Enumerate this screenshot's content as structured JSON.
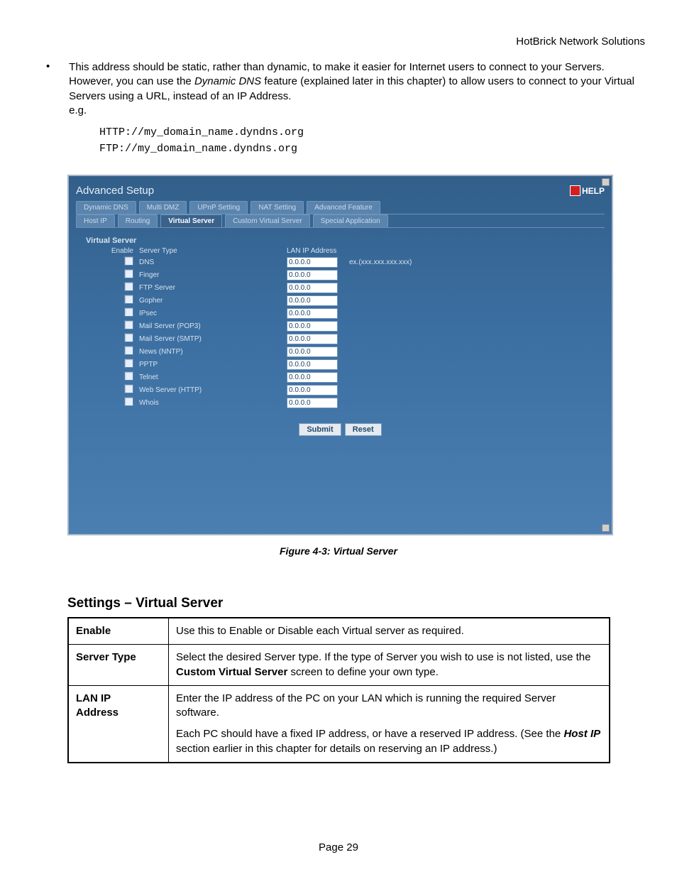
{
  "header": {
    "company": "HotBrick Network Solutions"
  },
  "bullet": {
    "text_before_italic": "This address should be static, rather than dynamic, to make it easier for Internet users to connect to your Servers. However, you can use the ",
    "italic": "Dynamic DNS",
    "text_after_italic": " feature (explained later in this chapter) to allow users to connect to your Virtual Servers using a URL, instead of an IP Address.",
    "eg": "e.g."
  },
  "code": {
    "line1": "HTTP://my_domain_name.dyndns.org",
    "line2": "FTP://my_domain_name.dyndns.org"
  },
  "shot": {
    "title": "Advanced Setup",
    "help": "HELP",
    "tabs1": [
      "Dynamic DNS",
      "Multi DMZ",
      "UPnP Setting",
      "NAT Setting",
      "Advanced Feature"
    ],
    "tabs2": [
      "Host IP",
      "Routing",
      "Virtual Server",
      "Custom Virtual Server",
      "Special Application"
    ],
    "tabs2_active": "Virtual Server",
    "section": "Virtual Server",
    "col_enable": "Enable",
    "col_type": "Server Type",
    "col_ip": "LAN IP Address",
    "hint": "ex.(xxx.xxx.xxx.xxx)",
    "rows": [
      {
        "type": "DNS",
        "ip": "0.0.0.0"
      },
      {
        "type": "Finger",
        "ip": "0.0.0.0"
      },
      {
        "type": "FTP Server",
        "ip": "0.0.0.0"
      },
      {
        "type": "Gopher",
        "ip": "0.0.0.0"
      },
      {
        "type": "IPsec",
        "ip": "0.0.0.0"
      },
      {
        "type": "Mail Server (POP3)",
        "ip": "0.0.0.0"
      },
      {
        "type": "Mail Server (SMTP)",
        "ip": "0.0.0.0"
      },
      {
        "type": "News (NNTP)",
        "ip": "0.0.0.0"
      },
      {
        "type": "PPTP",
        "ip": "0.0.0.0"
      },
      {
        "type": "Telnet",
        "ip": "0.0.0.0"
      },
      {
        "type": "Web Server (HTTP)",
        "ip": "0.0.0.0"
      },
      {
        "type": "Whois",
        "ip": "0.0.0.0"
      }
    ],
    "submit": "Submit",
    "reset": "Reset"
  },
  "caption": "Figure 4-3: Virtual Server",
  "settings_heading": "Settings – Virtual Server",
  "settings": {
    "enable_label": "Enable",
    "enable_text": "Use this to Enable or Disable each Virtual server as required.",
    "type_label": "Server Type",
    "type_text_a": "Select the desired Server type. If the type of Server you wish to use is not listed, use the ",
    "type_bold": "Custom Virtual Server",
    "type_text_b": " screen to define your own type.",
    "ip_label_a": "LAN IP",
    "ip_label_b": "Address",
    "ip_text1": "Enter the IP address of the PC on your LAN  which is running the required Server software.",
    "ip_text2a": "Each PC should have a fixed IP address, or have a reserved IP address. (See the ",
    "ip_text2_bi": "Host IP",
    "ip_text2b": " section earlier in this chapter for details on reserving an IP address.)"
  },
  "page": "Page 29"
}
